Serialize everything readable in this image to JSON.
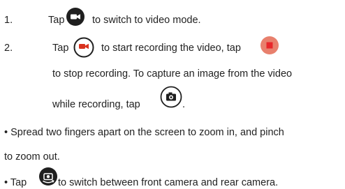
{
  "instructions": {
    "step1": {
      "number": "1.",
      "tap": "Tap",
      "text": "to switch to video mode."
    },
    "step2": {
      "number": "2.",
      "tap": "Tap",
      "text_a": "to start recording the video, tap",
      "text_b": "to stop recording. To capture an image from the video",
      "text_c": "while recording, tap",
      "text_d": "."
    },
    "bullet1": {
      "line1": "• Spread two fingers apart on the screen to zoom in, and pinch",
      "line2": "to zoom out."
    },
    "bullet2": {
      "tap": "• Tap",
      "text": "to switch between front camera and rear camera."
    }
  },
  "icons": {
    "video_mode": "video-camera-icon",
    "record": "record-icon",
    "stop": "stop-icon",
    "capture": "camera-icon",
    "switch_camera": "switch-camera-icon"
  },
  "colors": {
    "text": "#222222",
    "icon_dark": "#1f1f1f",
    "record_red": "#d9321e",
    "stop_bg": "#e8806d",
    "stop_square": "#e8262a"
  }
}
